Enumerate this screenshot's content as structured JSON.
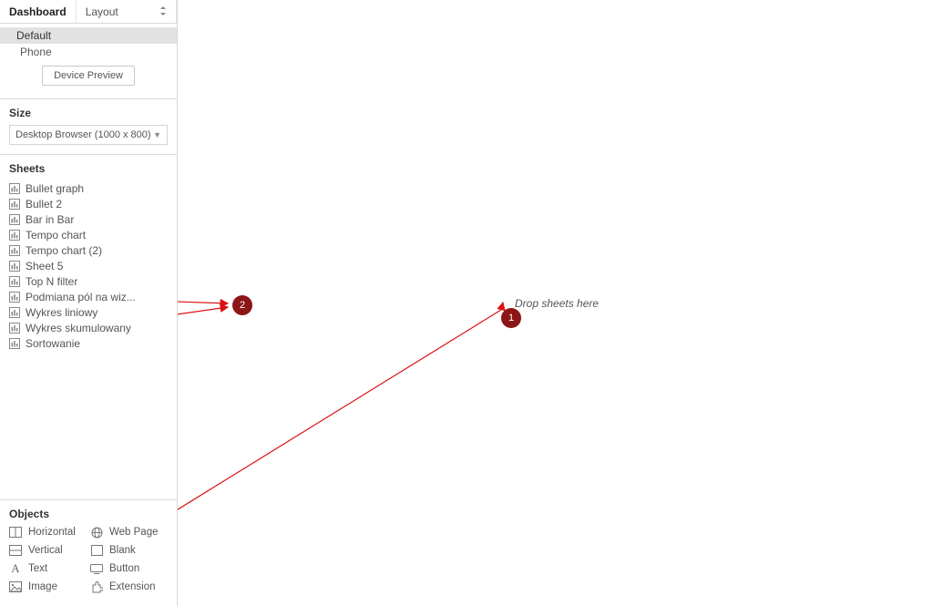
{
  "tabs": {
    "dashboard": "Dashboard",
    "layout": "Layout"
  },
  "devices": {
    "default": "Default",
    "phone": "Phone",
    "preview_button": "Device Preview"
  },
  "size_section": {
    "title": "Size",
    "value": "Desktop Browser (1000 x 800)"
  },
  "sheets_section": {
    "title": "Sheets",
    "items": [
      "Bullet graph",
      "Bullet 2",
      "Bar in Bar",
      "Tempo chart",
      "Tempo chart (2)",
      "Sheet 5",
      "Top N filter",
      "Podmiana pól na wiz...",
      "Wykres liniowy",
      "Wykres skumulowany",
      "Sortowanie"
    ]
  },
  "objects_section": {
    "title": "Objects",
    "items": {
      "horizontal": "Horizontal",
      "webpage": "Web Page",
      "vertical": "Vertical",
      "blank": "Blank",
      "text": "Text",
      "button": "Button",
      "image": "Image",
      "extension": "Extension"
    }
  },
  "canvas": {
    "drop_hint": "Drop sheets here"
  },
  "annotations": {
    "badge1": "1",
    "badge2": "2"
  }
}
